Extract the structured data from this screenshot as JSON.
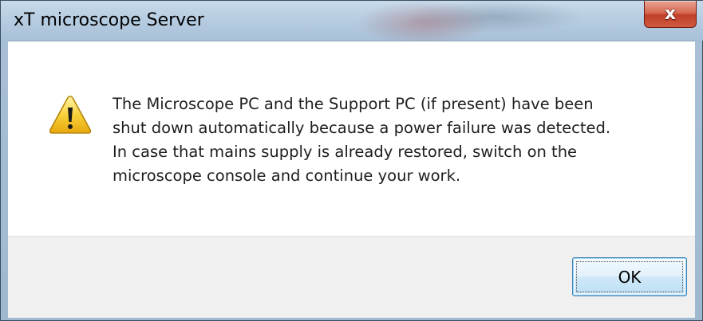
{
  "window": {
    "title": "xT microscope Server",
    "close_glyph": "x"
  },
  "dialog": {
    "icon": "warning-icon",
    "message_lines": [
      "The Microscope PC and the Support PC (if present) have been",
      "shut down automatically because a power failure was detected.",
      "In case that mains supply is already restored, switch on the",
      "microscope console and continue your work."
    ],
    "ok_label": "OK"
  },
  "colors": {
    "warning_fill": "#f2c21b",
    "close_button": "#c94a33",
    "ok_border": "#3c7fb1"
  }
}
